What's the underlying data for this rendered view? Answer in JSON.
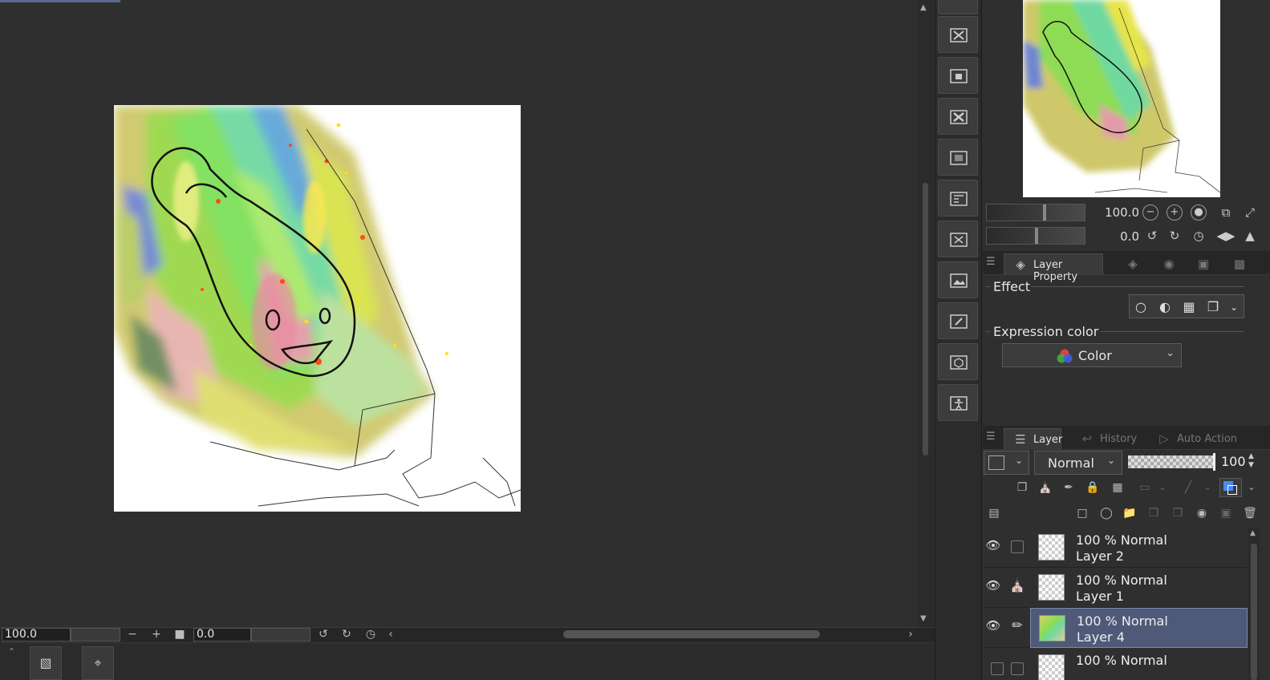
{
  "canvas": {
    "zoom_value": "100.0",
    "rotate_value": "0.0"
  },
  "navigator": {
    "zoom_value": "100.0",
    "rotate_value": "0.0"
  },
  "property_panel": {
    "tab_active": "Layer Property",
    "effect_label": "Effect",
    "expression_color_label": "Expression color",
    "expression_color_value": "Color"
  },
  "layer_panel": {
    "tabs": [
      "Layer",
      "History",
      "Auto Action"
    ],
    "blend_mode": "Normal",
    "opacity": "100",
    "layers": [
      {
        "mode": "100 % Normal",
        "name": "Layer 2",
        "selected": false
      },
      {
        "mode": "100 % Normal",
        "name": "Layer 1",
        "selected": false
      },
      {
        "mode": "100 % Normal",
        "name": "Layer 4",
        "selected": true
      },
      {
        "mode": "100 % Normal",
        "name": "",
        "selected": false
      }
    ]
  },
  "icons": {
    "eye": "eye-icon",
    "pencil": "pencil-icon",
    "reference": "reference-layer-icon"
  },
  "colors": {
    "selected_layer": "#4e5a78",
    "panel_bg": "#2f2f2f"
  }
}
